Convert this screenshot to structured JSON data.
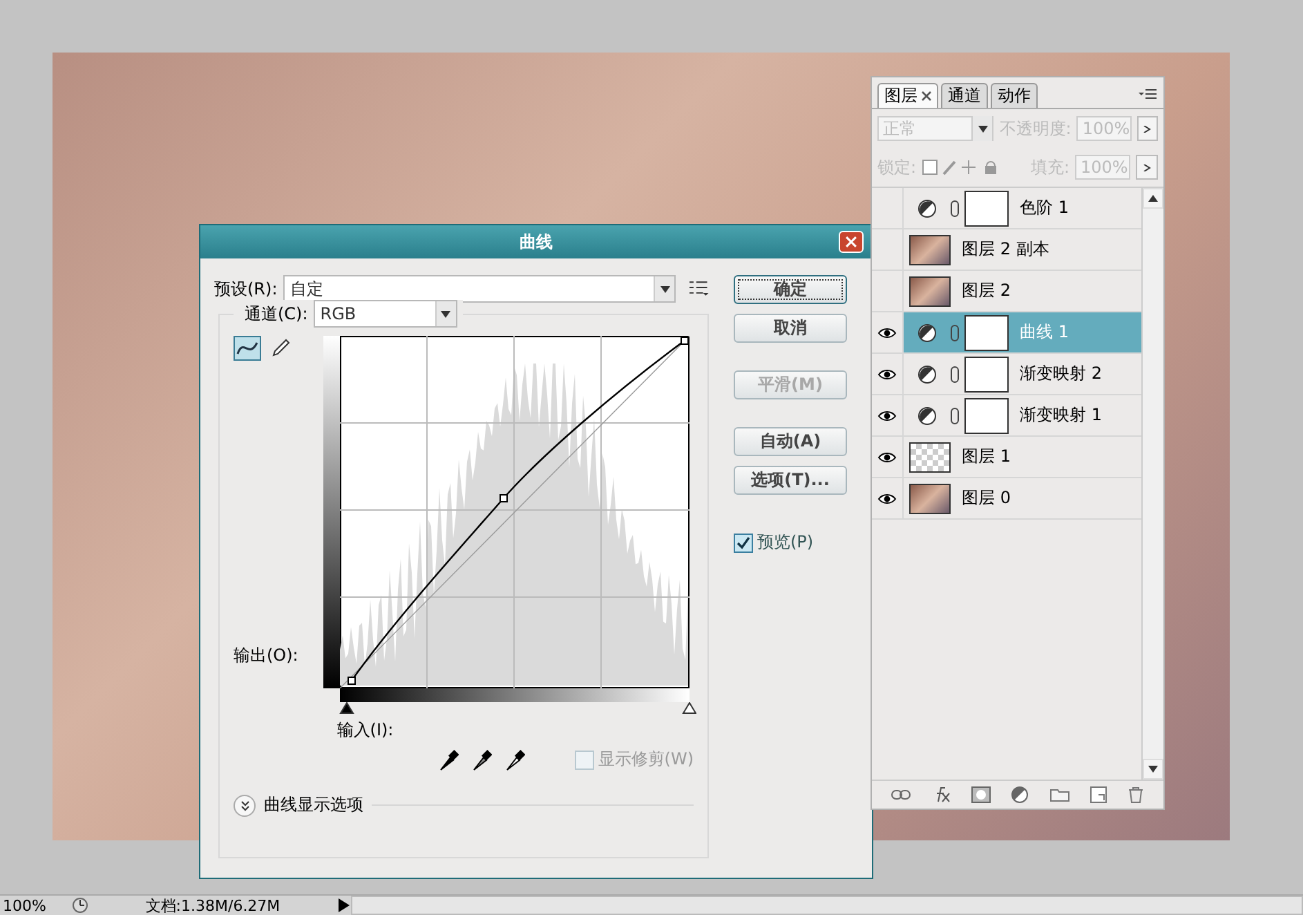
{
  "curves_dialog": {
    "title": "曲线",
    "preset_label": "预设(R):",
    "preset_value": "自定",
    "channel_label": "通道(C):",
    "channel_value": "RGB",
    "tools": [
      {
        "kind": "curve",
        "selected": true
      },
      {
        "kind": "pencil",
        "selected": false
      }
    ],
    "output_label": "输出(O):",
    "input_label": "输入(I):",
    "buttons": [
      {
        "label": "确定",
        "disabled": false,
        "default": true
      },
      {
        "label": "取消",
        "disabled": false,
        "default": false
      },
      {
        "label": "平滑(M)",
        "disabled": true,
        "default": false
      },
      {
        "label": "自动(A)",
        "disabled": false,
        "default": false
      },
      {
        "label": "选项(T)...",
        "disabled": false,
        "default": false
      }
    ],
    "preview": {
      "label": "预览(P)",
      "checked": true
    },
    "show_clipping": {
      "label": "显示修剪(W)",
      "checked": false,
      "disabled": true
    },
    "display_options": "曲线显示选项"
  },
  "layers_panel": {
    "tabs": [
      {
        "label": "图层",
        "selected": true
      },
      {
        "label": "通道",
        "selected": false
      },
      {
        "label": "动作",
        "selected": false
      }
    ],
    "blend_mode": "正常",
    "opacity_label": "不透明度:",
    "opacity": "100%",
    "lock_label": "锁定:",
    "fill_label": "填充:",
    "fill": "100%",
    "layers": [
      {
        "name": "色阶 1",
        "kind": "adjustment",
        "visible": false,
        "selected": false
      },
      {
        "name": "图层 2 副本",
        "kind": "photo",
        "visible": false,
        "selected": false
      },
      {
        "name": "图层 2",
        "kind": "photo",
        "visible": false,
        "selected": false
      },
      {
        "name": "曲线 1",
        "kind": "adjustment",
        "visible": true,
        "selected": true
      },
      {
        "name": "渐变映射 2",
        "kind": "adjustment",
        "visible": true,
        "selected": false
      },
      {
        "name": "渐变映射 1",
        "kind": "adjustment",
        "visible": true,
        "selected": false
      },
      {
        "name": "图层 1",
        "kind": "transparent",
        "visible": true,
        "selected": false
      },
      {
        "name": "图层 0",
        "kind": "photo",
        "visible": true,
        "selected": false
      }
    ]
  },
  "status_bar": {
    "zoom": "100%",
    "document": "文档:1.38M/6.27M"
  }
}
